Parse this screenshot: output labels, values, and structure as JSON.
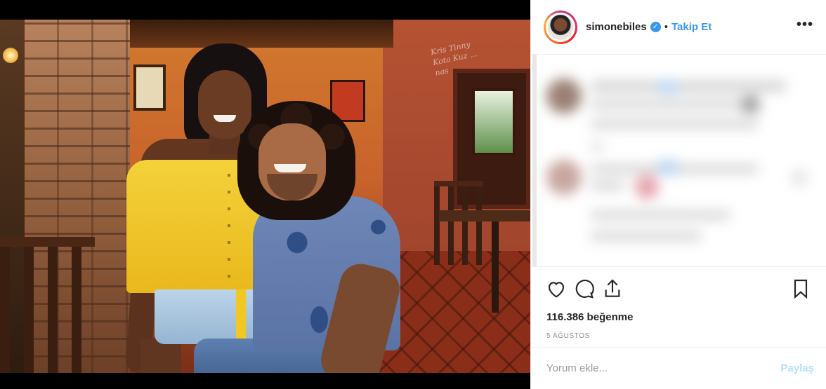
{
  "post": {
    "image_alt": "",
    "wall_text": [
      "Kris Tinny",
      "Kota Kuz ...",
      "nas"
    ]
  },
  "header": {
    "username": "simonebiles",
    "verified_icon": "verified-badge-icon",
    "separator": "•",
    "follow_label": "Takip Et",
    "more_label": "•••"
  },
  "actions": {
    "icons": [
      "heart-icon",
      "comment-icon",
      "share-icon",
      "bookmark-icon"
    ]
  },
  "likes": {
    "text": "116.386 beğenme"
  },
  "date": {
    "text": "5 AĞUSTOS"
  },
  "comment_box": {
    "placeholder": "Yorum ekle...",
    "share_label": "Paylaş"
  },
  "colors": {
    "link_blue": "#3897f0",
    "share_disabled": "#b2dffc",
    "text": "#262626",
    "muted": "#8e8e8e"
  }
}
